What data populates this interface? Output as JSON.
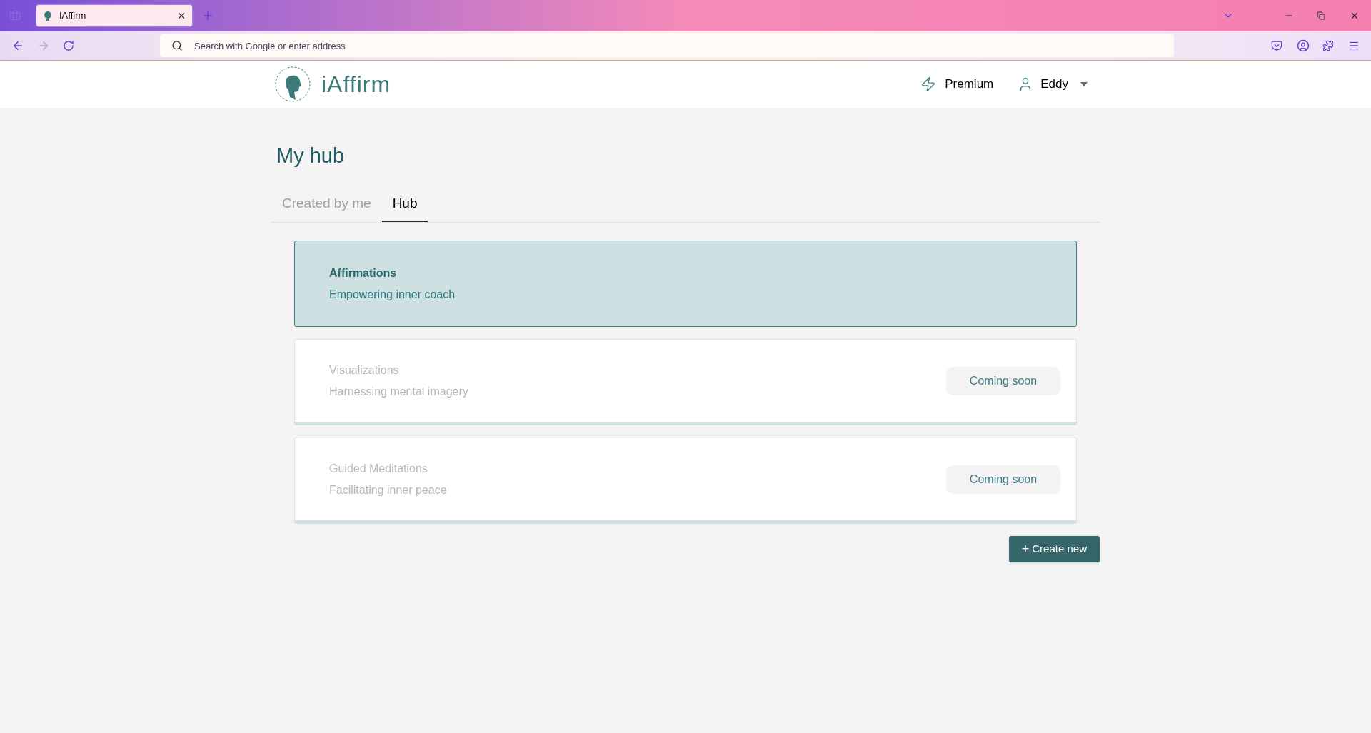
{
  "browser": {
    "tabs": [
      {
        "title": "IAffirm",
        "selected": true
      }
    ],
    "address_placeholder": "Search with Google or enter address"
  },
  "header": {
    "logo_text": "iAffirm",
    "premium": "Premium",
    "user": "Eddy"
  },
  "page": {
    "title": "My hub"
  },
  "tabs": [
    {
      "label": "Created by me",
      "selected": false
    },
    {
      "label": "Hub",
      "selected": true
    }
  ],
  "cards": [
    {
      "title": "Affirmations",
      "subtitle": "Empowering inner coach",
      "selected": true,
      "disabled": false
    },
    {
      "title": "Visualizations",
      "subtitle": "Harnessing mental imagery",
      "selected": false,
      "disabled": true,
      "badge": "Coming soon"
    },
    {
      "title": "Guided Meditations",
      "subtitle": "Facilitating inner peace",
      "selected": false,
      "disabled": true,
      "badge": "Coming soon"
    }
  ],
  "create_button": {
    "icon": "+",
    "label": "Create new"
  }
}
